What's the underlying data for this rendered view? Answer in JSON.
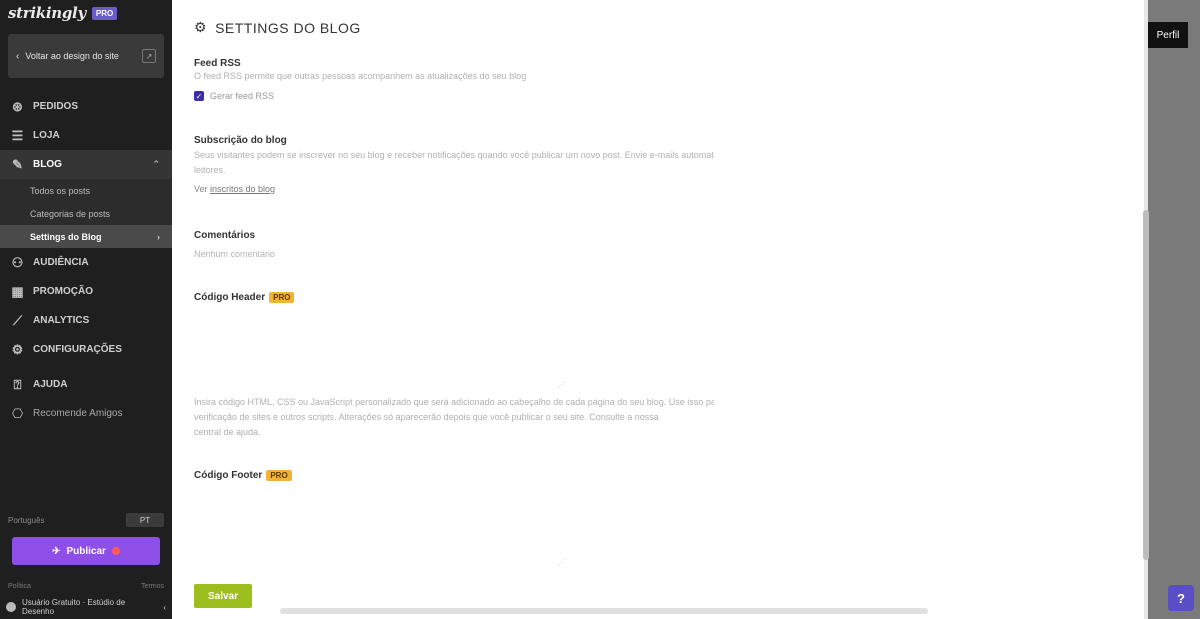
{
  "sidebar": {
    "logo": "strikingly",
    "plan_badge": "PRO",
    "back_button": "Voltar ao design do site",
    "nav": [
      {
        "label": "PEDIDOS",
        "icon": "dollar-circle-icon"
      },
      {
        "label": "LOJA",
        "icon": "store-icon"
      },
      {
        "label": "BLOG",
        "icon": "blog-pen-icon"
      },
      {
        "label": "AUDIÊNCIA",
        "icon": "audience-icon"
      },
      {
        "label": "PROMOÇÃO",
        "icon": "promotion-icon"
      },
      {
        "label": "ANALYTICS",
        "icon": "analytics-icon"
      },
      {
        "label": "CONFIGURAÇÕES",
        "icon": "settings-icon"
      },
      {
        "label": "AJUDA",
        "icon": "help-icon"
      },
      {
        "label": "Recomende Amigos",
        "icon": "gift-icon"
      }
    ],
    "blog_sub": [
      {
        "label": "Todos os posts"
      },
      {
        "label": "Categorias de posts"
      },
      {
        "label": "Settings do Blog"
      }
    ],
    "language_label": "Português",
    "language_toggle": "PT",
    "publish_label": "Publicar",
    "footer_left": "Política",
    "footer_right": "Termos",
    "user_name": "Usuário Gratuito · Estúdio de Desenho"
  },
  "panel": {
    "title": "SETTINGS DO BLOG",
    "rss": {
      "label": "Feed RSS",
      "desc": "O feed RSS permite que outras pessoas acompanhem as atualizações do seu blog",
      "checkbox_label": "Gerar feed RSS"
    },
    "subscription": {
      "label": "Subscrição do blog",
      "desc": "Seus visitantes podem se inscrever no seu blog e receber notificações quando você publicar um novo post. Envie e-mails automaticamente para seus",
      "desc2": "leitores.",
      "link_prefix": "Ver",
      "link": "inscritos do blog"
    },
    "comments": {
      "label": "Comentários",
      "placeholder": "Nenhum comentário"
    },
    "header_code": {
      "label": "Código Header",
      "badge": "PRO",
      "help1": "Insira código HTML, CSS ou JavaScript personalizado que será adicionado ao cabeçalho de cada página do seu blog. Use isso para ferramentas de analytics,",
      "help2": "verificação de sites e outros scripts. Alterações só aparecerão depois que você publicar o seu site. Consulte a nossa",
      "help3": "central de ajuda."
    },
    "footer_code": {
      "label": "Código Footer",
      "badge": "PRO"
    },
    "save_label": "Salvar"
  },
  "top_right_button": "Perfil",
  "help_button": "?"
}
